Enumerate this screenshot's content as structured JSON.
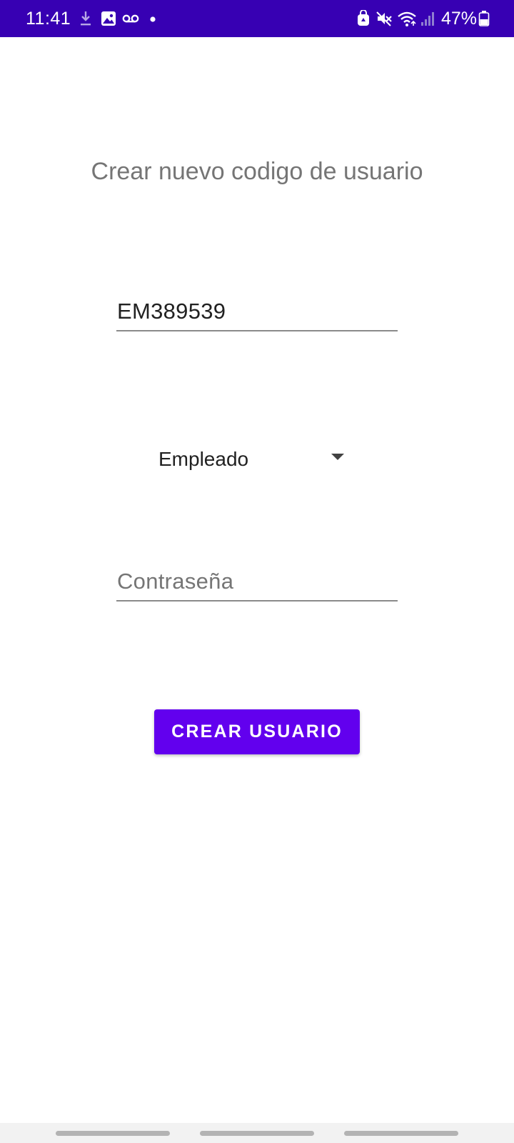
{
  "status_bar": {
    "time": "11:41",
    "battery_percent": "47%",
    "background_color": "#3700b3",
    "icons_left": [
      "download-icon",
      "image-icon",
      "voicemail-icon",
      "notification-dot-icon"
    ],
    "icons_right": [
      "battery-saver-icon",
      "mute-icon",
      "wifi-icon",
      "signal-icon",
      "battery-icon"
    ]
  },
  "form": {
    "title": "Crear nuevo codigo de usuario",
    "user_code_value": "EM389539",
    "role_selected": "Empleado",
    "password_placeholder": "Contraseña",
    "submit_label": "CREAR USUARIO",
    "accent_color": "#6200ee"
  }
}
